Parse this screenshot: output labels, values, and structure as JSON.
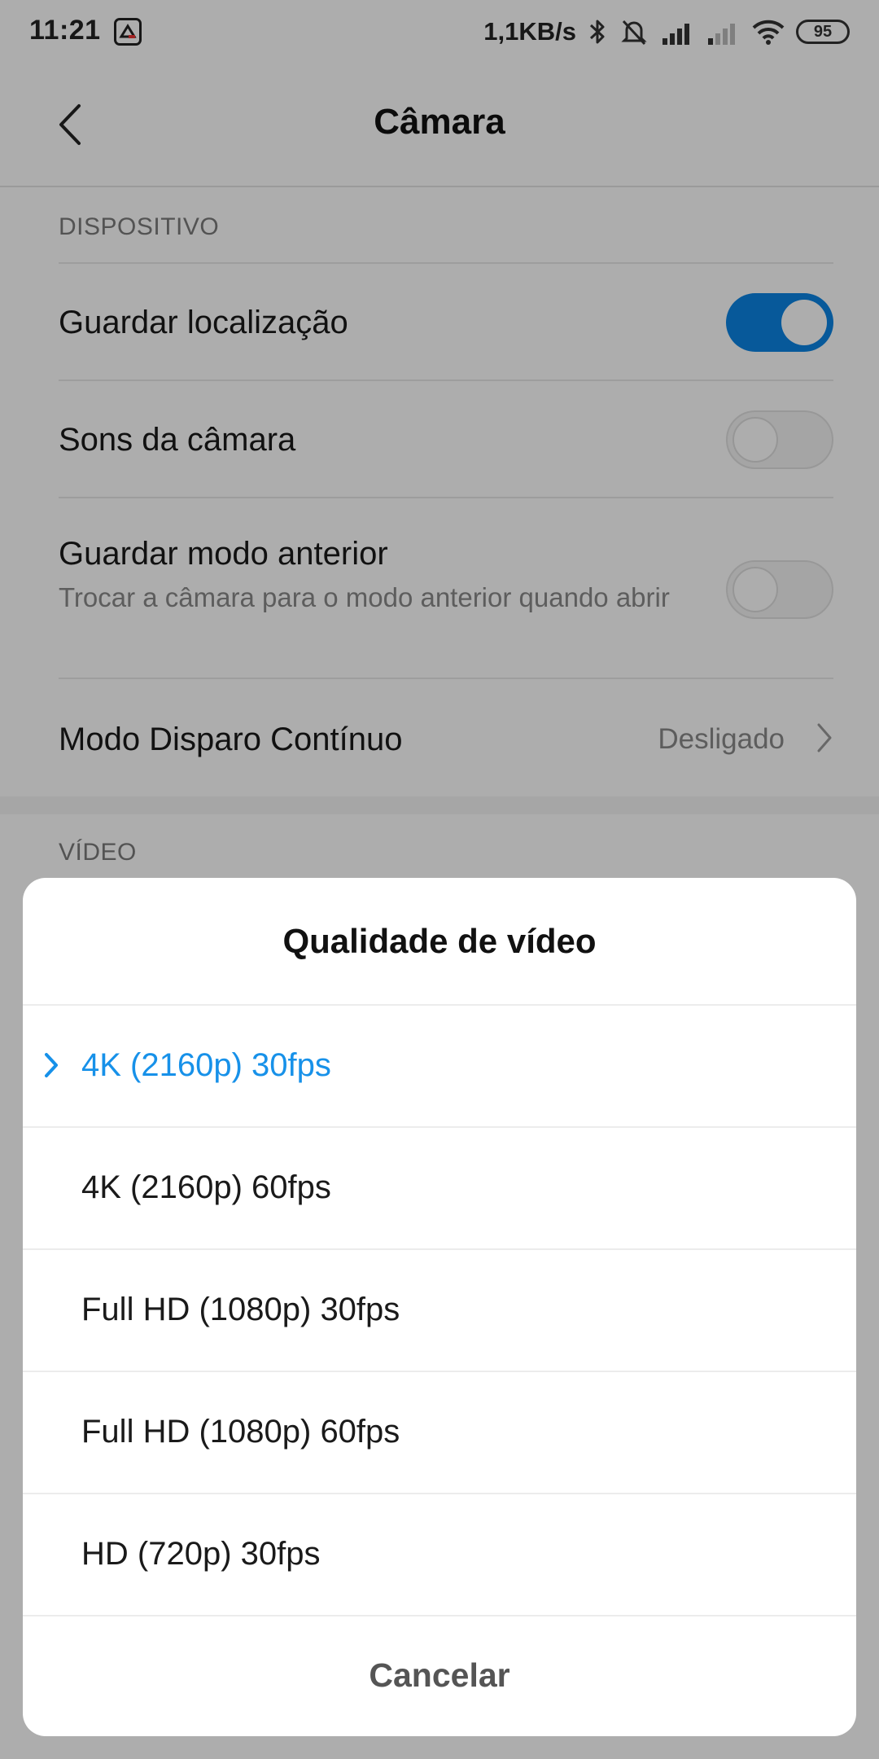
{
  "status_bar": {
    "time": "11:21",
    "network_speed": "1,1KB/s",
    "battery_level": "95",
    "icons": [
      "app-notification-icon",
      "bluetooth-icon",
      "alarm-off-icon",
      "signal-icon",
      "signal-weak-icon",
      "wifi-icon",
      "battery-icon"
    ]
  },
  "header": {
    "title": "Câmara",
    "back_icon": "chevron-left-icon"
  },
  "sections": {
    "device": {
      "label": "DISPOSITIVO",
      "rows": [
        {
          "title": "Guardar localização",
          "toggle": "on"
        },
        {
          "title": "Sons da câmara",
          "toggle": "off"
        },
        {
          "title": "Guardar modo anterior",
          "subtitle": "Trocar a câmara para o modo anterior quando abrir",
          "toggle": "off"
        },
        {
          "title": "Modo Disparo Contínuo",
          "value": "Desligado",
          "icon": "chevron-right-icon"
        }
      ]
    },
    "video": {
      "label": "VÍDEO"
    }
  },
  "dialog": {
    "title": "Qualidade de vídeo",
    "options": [
      {
        "label": "4K (2160p) 30fps",
        "selected": true
      },
      {
        "label": "4K (2160p) 60fps",
        "selected": false
      },
      {
        "label": "Full HD (1080p) 30fps",
        "selected": false
      },
      {
        "label": "Full HD (1080p) 60fps",
        "selected": false
      },
      {
        "label": "HD (720p) 30fps",
        "selected": false
      }
    ],
    "cancel_label": "Cancelar"
  },
  "colors": {
    "accent": "#0b84e3",
    "selected_text": "#1791e9",
    "overlay": "rgba(0,0,0,0.32)"
  }
}
